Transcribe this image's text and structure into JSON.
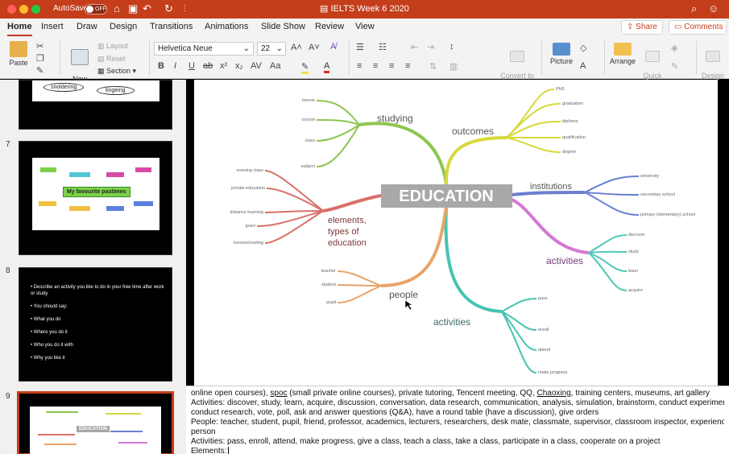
{
  "titlebar": {
    "autosave_label": "AutoSave",
    "autosave_state": "OFF",
    "document_title": "IELTS Week 6 2020"
  },
  "tabs": [
    "Home",
    "Insert",
    "Draw",
    "Design",
    "Transitions",
    "Animations",
    "Slide Show",
    "Review",
    "View"
  ],
  "share_label": "Share",
  "comments_label": "Comments",
  "ribbon": {
    "paste": "Paste",
    "new_slide": "New\nSlide",
    "layout": "Layout",
    "reset": "Reset",
    "section": "Section",
    "font_name": "Helvetica Neue",
    "font_size": "22",
    "convert_smartart": "Convert to\nSmartArt",
    "picture": "Picture",
    "arrange": "Arrange",
    "quick_styles": "Quick\nStyles",
    "design_ideas": "Design\nIdeas"
  },
  "slides_panel": {
    "thumb6_words": [
      "snoldering",
      "tingeing"
    ],
    "slide7_number": "7",
    "slide7_title": "My favourite pastimes",
    "slide8_number": "8",
    "slide8_bullets": [
      "Describe an activity you like to do in your free time after work or study",
      "You should say:",
      "What you do",
      "Where you do it",
      "Who you do it with",
      "Why you like it"
    ],
    "slide9_number": "9",
    "slide9_center": "EDUCATION"
  },
  "mindmap": {
    "center": "EDUCATION",
    "branches": {
      "studying": {
        "label": "studying",
        "leaves": [
          "lesson",
          "course",
          "class",
          "subject"
        ]
      },
      "outcomes": {
        "label": "outcomes",
        "leaves": [
          "PhD",
          "graduation",
          "diploma",
          "qualification",
          "degree"
        ]
      },
      "institutions": {
        "label": "institutions",
        "leaves": [
          "university",
          "secondary school",
          "primary (elementary) school"
        ]
      },
      "activities_right": {
        "label": "activities",
        "leaves": [
          "discover",
          "study",
          "learn",
          "acquire"
        ]
      },
      "activities_bottom": {
        "label": "activities",
        "leaves": [
          "pass",
          "enroll",
          "attend",
          "make progress"
        ]
      },
      "people": {
        "label": "people",
        "leaves": [
          "teacher",
          "student",
          "pupil"
        ]
      },
      "elements": {
        "label": "elements,\ntypes of\neducation",
        "leaves": [
          "evening class",
          "private education",
          "distance learning",
          "grant",
          "homeschooling"
        ]
      }
    },
    "colors": {
      "studying": "#8dc64f",
      "outcomes": "#d8d83a",
      "institutions": "#6b7fcf",
      "activities_right": "#4fc8b8",
      "activities_bottom": "#46c4b0",
      "people": "#e8a46a",
      "elements": "#d9706a",
      "center_bg": "#a8a8a8"
    }
  },
  "notes": {
    "line1": "online open courses), spoc (small private online courses), private tutoring, Tencent meeting, QQ, Chaoxing, training centers, museums, art gallery",
    "line2": "Activities: discover, study, learn, acquire, discussion, conversation, data research, communication, analysis, simulation, brainstorm, conduct experiments/",
    "line3": "conduct research, vote, poll, ask and answer questions (Q&A), have a round table (have a discussion), give orders",
    "line4": "People: teacher, student, pupil, friend, professor, academics, lecturers, researchers, desk mate, classmate,  supervisor, classroom inspector, experienced",
    "line5": "person",
    "line6": "Activities: pass, enroll, attend, make progress, give a class, teach a class, take a class, participate in a class, cooperate on a project",
    "line7": "Elements:"
  }
}
